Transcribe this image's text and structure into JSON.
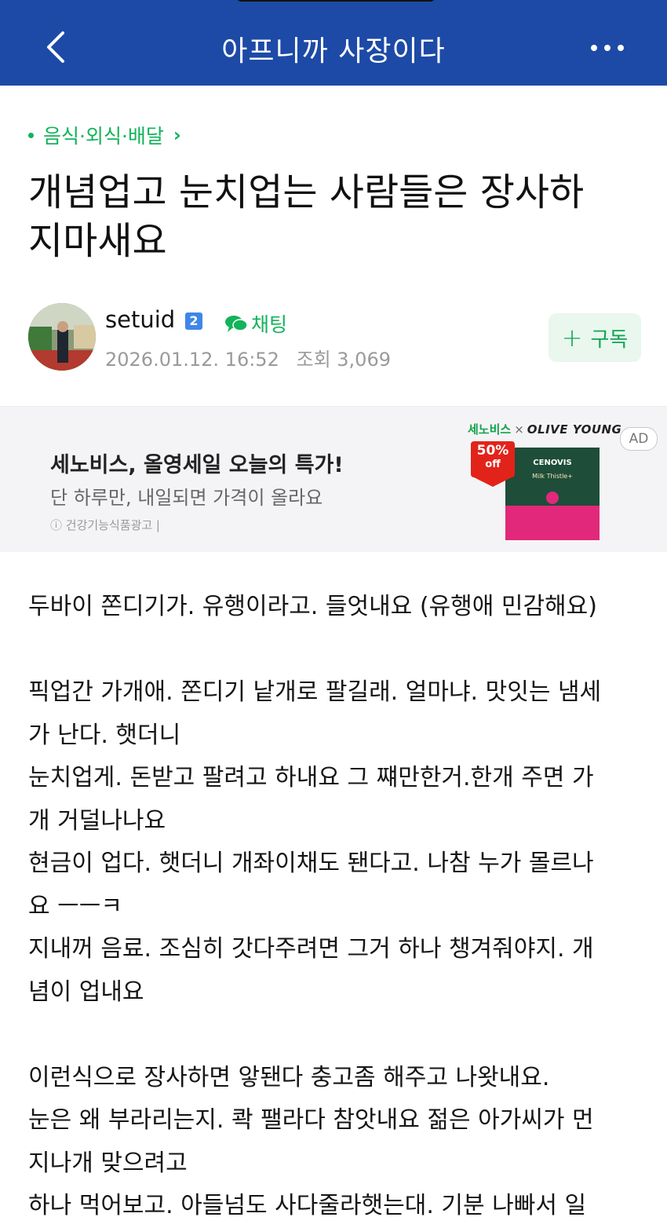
{
  "header": {
    "title": "아프니까 사장이다",
    "back_icon": "chevron-left-icon",
    "more_icon": "more-horizontal-icon"
  },
  "post": {
    "category": "음식·외식·배달",
    "title_lines": [
      "개념업고 눈치업는 사람들은 장사하",
      "지마새요"
    ],
    "author": {
      "name": "setuid",
      "level": "2",
      "chat_label": "채팅",
      "date": "2026.01.12. 16:52",
      "views": "조회 3,069"
    },
    "subscribe_label": "구독"
  },
  "ad": {
    "headline": "세노비스, 올영세일 오늘의 특가!",
    "subtext": "단 하루만, 내일되면 가격이 올라요",
    "note": "ⓘ 건강기능식품광고 |",
    "brand": "세노비스",
    "partner": "OLIVE YOUNG",
    "badge": "AD",
    "sale_percent": "50%",
    "sale_off": "off",
    "product_brand": "CENOVIS",
    "product_name": "Milk Thistle+"
  },
  "body_lines": [
    "두바이 쫀디기가. 유행이라고. 들엇내요 (유행애 민감해요)",
    "",
    "픽업간 가개애. 쫀디기 낱개로 팔길래. 얼마냐. 맛잇는 냄세",
    "가 난다. 햇더니",
    "눈치업게. 돈받고 팔려고 하내요 그 쨰만한거.한개 주면 가",
    "개 거덜나나요",
    "현금이 업다. 햇더니 개좌이채도 됀다고. 나참 누가 몰르나",
    "요 ㅡㅡㅋ",
    "지내꺼 음료. 조심히 갓다주려면 그거 하나 챙겨줘야지. 개",
    "념이 업내요",
    "",
    "이런식으로 장사하면 앟됀다 충고좀 해주고 나왓내요.",
    "눈은 왜 부라리는지. 콱 팰라다 참앗내요 젊은 아가씨가 먼",
    "지나개 맞으려고",
    "하나 먹어보고. 아들넘도 사다줄라햇는대. 기분 나빠서 일"
  ],
  "colors": {
    "header_bg": "#1d4aa6",
    "accent_green": "#12b35a",
    "subscribe_bg": "#e9f7ee"
  }
}
